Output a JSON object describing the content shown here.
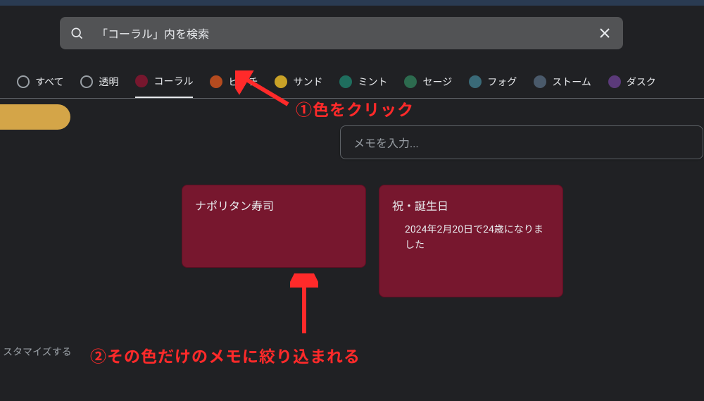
{
  "search": {
    "placeholder": "「コーラル」内を検索"
  },
  "filters": [
    {
      "label": "すべて",
      "color": "transparent",
      "border": "#9aa0a6",
      "active": false
    },
    {
      "label": "透明",
      "color": "transparent",
      "border": "#9aa0a6",
      "active": false
    },
    {
      "label": "コーラル",
      "color": "#77172e",
      "border": "#77172e",
      "active": true
    },
    {
      "label": "ピーチ",
      "color": "#b44b1f",
      "border": "#b44b1f",
      "active": false
    },
    {
      "label": "サンド",
      "color": "#c9a227",
      "border": "#c9a227",
      "active": false
    },
    {
      "label": "ミント",
      "color": "#1f6e5e",
      "border": "#1f6e5e",
      "active": false
    },
    {
      "label": "セージ",
      "color": "#2d6b4f",
      "border": "#2d6b4f",
      "active": false
    },
    {
      "label": "フォグ",
      "color": "#3a6a78",
      "border": "#3a6a78",
      "active": false
    },
    {
      "label": "ストーム",
      "color": "#4a5a6b",
      "border": "#4a5a6b",
      "active": false
    },
    {
      "label": "ダスク",
      "color": "#5b3a7a",
      "border": "#5b3a7a",
      "active": false
    }
  ],
  "note_input": {
    "placeholder": "メモを入力..."
  },
  "notes": [
    {
      "title": "ナポリタン寿司",
      "body": ""
    },
    {
      "title": "祝・誕生日",
      "body": "2024年2月20日で24歳になりました"
    }
  ],
  "customize": "スタマイズする",
  "annotations": {
    "a1": "①色をクリック",
    "a2": "②その色だけのメモに絞り込まれる"
  }
}
